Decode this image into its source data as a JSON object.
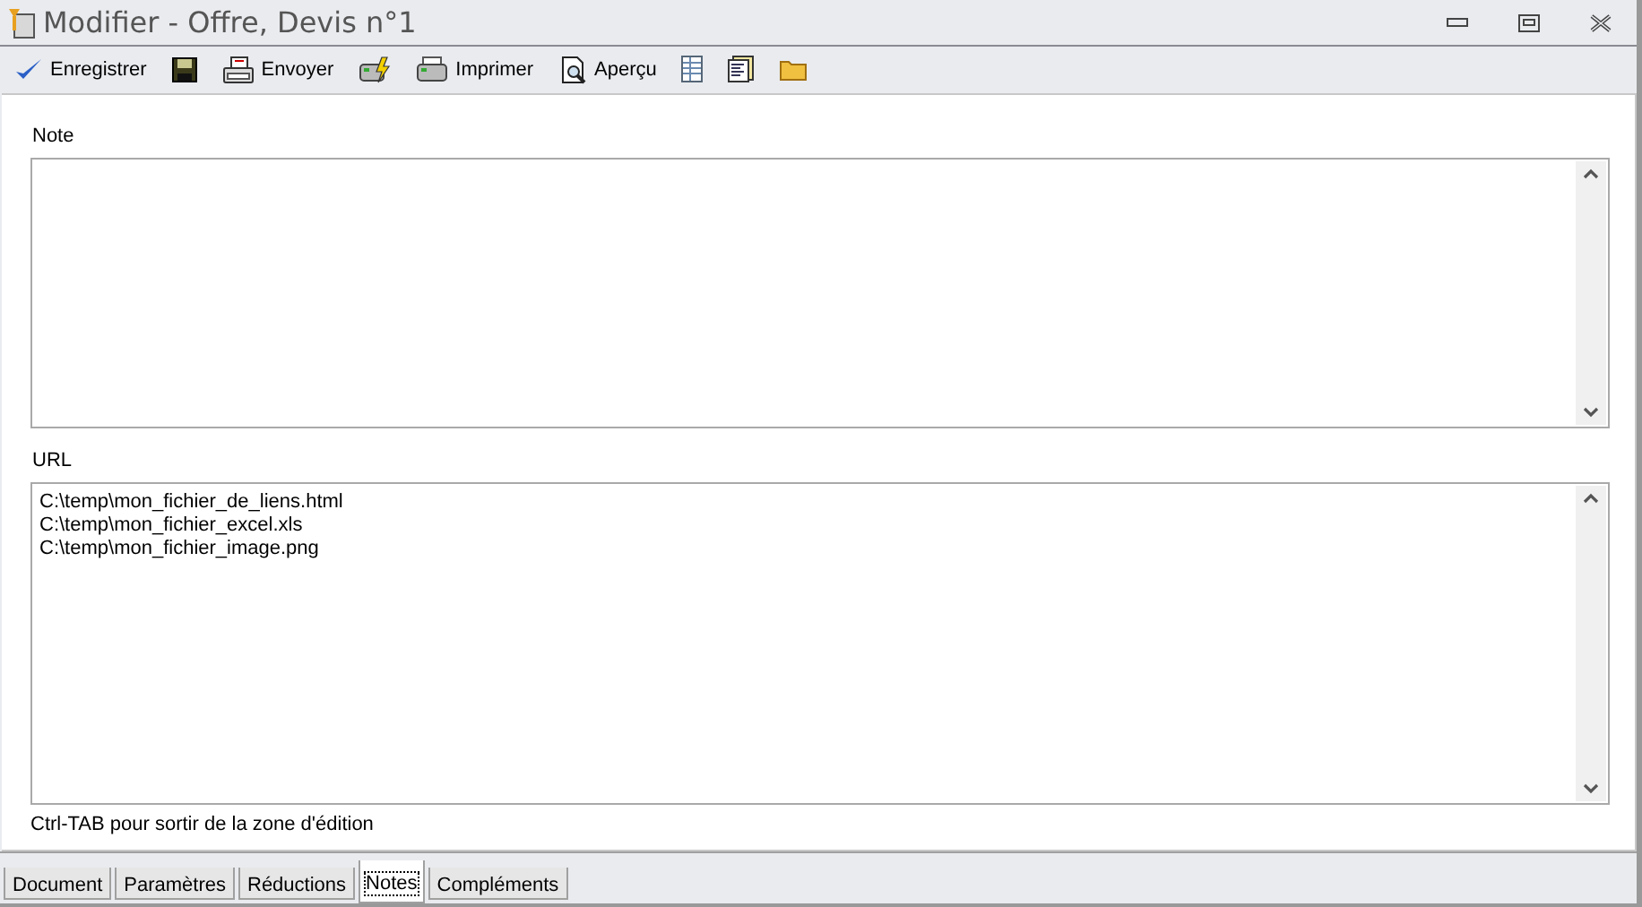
{
  "window": {
    "title": "Modifier - Offre, Devis n°1"
  },
  "toolbar": [
    {
      "kind": "check",
      "label": "Enregistrer"
    },
    {
      "kind": "save"
    },
    {
      "kind": "send",
      "label": "Envoyer"
    },
    {
      "kind": "fastprint"
    },
    {
      "kind": "print",
      "label": "Imprimer"
    },
    {
      "kind": "preview",
      "label": "Aperçu"
    },
    {
      "kind": "sheet"
    },
    {
      "kind": "doc"
    },
    {
      "kind": "folder"
    }
  ],
  "note": {
    "label": "Note"
  },
  "url": {
    "label": "URL",
    "lines": [
      "C:\\temp\\mon_fichier_de_liens.html",
      "C:\\temp\\mon_fichier_excel.xls",
      "C:\\temp\\mon_fichier_image.png"
    ]
  },
  "hint": "Ctrl-TAB pour sortir de la zone d'édition",
  "tabs": [
    {
      "label": "Document",
      "selected": false
    },
    {
      "label": "Paramètres",
      "selected": false
    },
    {
      "label": "Réductions",
      "selected": false
    },
    {
      "label": "Notes",
      "selected": true
    },
    {
      "label": "Compléments",
      "selected": false
    }
  ]
}
